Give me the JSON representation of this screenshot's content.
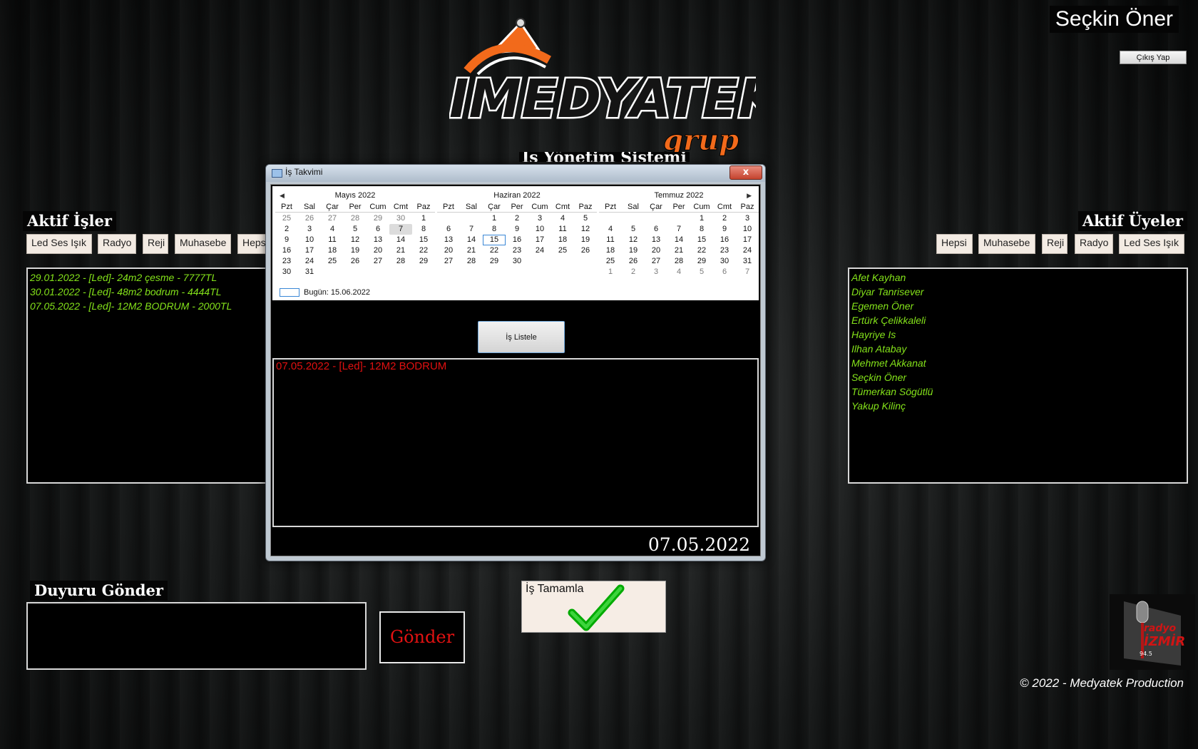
{
  "user_name": "Seçkin Öner",
  "logout_label": "Çıkış Yap",
  "logo": {
    "text": "IMEDYATEK",
    "sub": "grup"
  },
  "system_title_partial": "İş Yönetim Sistemi",
  "active_jobs": {
    "title": "Aktif İşler",
    "filters": [
      "Led Ses Işık",
      "Radyo",
      "Reji",
      "Muhasebe",
      "Hepsi"
    ],
    "items": [
      "29.01.2022 - [Led]- 24m2 çesme - 7777TL",
      "30.01.2022 - [Led]- 48m2 bodrum - 4444TL",
      "07.05.2022 - [Led]- 12M2 BODRUM - 2000TL"
    ]
  },
  "active_members": {
    "title": "Aktif Üyeler",
    "filters": [
      "Hepsi",
      "Muhasebe",
      "Reji",
      "Radyo",
      "Led Ses Işık"
    ],
    "items": [
      "Afet Kayhan",
      "Diyar Tanrisever",
      "Egemen Öner",
      "Ertürk Çelikkaleli",
      "Hayriye Is",
      "Ilhan Atabay",
      "Mehmet Akkanat",
      "Seçkin Öner",
      "Tümerkan Sögütlü",
      "Yakup Kilinç"
    ]
  },
  "dialog": {
    "title": "İş Takvimi",
    "close_label": "x",
    "calendar": {
      "dow": [
        "Pzt",
        "Sal",
        "Çar",
        "Per",
        "Cum",
        "Cmt",
        "Paz"
      ],
      "months": [
        {
          "title": "Mayıs 2022",
          "weeks": [
            [
              "25",
              "26",
              "27",
              "28",
              "29",
              "30",
              "1"
            ],
            [
              "2",
              "3",
              "4",
              "5",
              "6",
              "7",
              "8"
            ],
            [
              "9",
              "10",
              "11",
              "12",
              "13",
              "14",
              "15"
            ],
            [
              "16",
              "17",
              "18",
              "19",
              "20",
              "21",
              "22"
            ],
            [
              "23",
              "24",
              "25",
              "26",
              "27",
              "28",
              "29"
            ],
            [
              "30",
              "31",
              "",
              "",
              "",
              "",
              ""
            ]
          ]
        },
        {
          "title": "Haziran 2022",
          "weeks": [
            [
              "",
              "",
              "1",
              "2",
              "3",
              "4",
              "5"
            ],
            [
              "6",
              "7",
              "8",
              "9",
              "10",
              "11",
              "12"
            ],
            [
              "13",
              "14",
              "15",
              "16",
              "17",
              "18",
              "19"
            ],
            [
              "20",
              "21",
              "22",
              "23",
              "24",
              "25",
              "26"
            ],
            [
              "27",
              "28",
              "29",
              "30",
              "",
              "",
              ""
            ],
            [
              "",
              "",
              "",
              "",
              "",
              "",
              ""
            ]
          ]
        },
        {
          "title": "Temmuz 2022",
          "weeks": [
            [
              "",
              "",
              "",
              "",
              "1",
              "2",
              "3"
            ],
            [
              "4",
              "5",
              "6",
              "7",
              "8",
              "9",
              "10"
            ],
            [
              "11",
              "12",
              "13",
              "14",
              "15",
              "16",
              "17"
            ],
            [
              "18",
              "19",
              "20",
              "21",
              "22",
              "23",
              "24"
            ],
            [
              "25",
              "26",
              "27",
              "28",
              "29",
              "30",
              "31"
            ],
            [
              "1",
              "2",
              "3",
              "4",
              "5",
              "6",
              "7"
            ]
          ]
        }
      ],
      "today_label": "Bugün: 15.06.2022"
    },
    "list_button": "İş Listele",
    "results": [
      "07.05.2022 - [Led]- 12M2 BODRUM"
    ],
    "selected_date": "07.05.2022"
  },
  "announcement": {
    "title": "Duyuru Gönder",
    "send_label": "Gönder"
  },
  "complete_job_label": "İş Tamamla",
  "radio_logo": {
    "line1": "radyo",
    "line2": "İZMİR",
    "line3": "94.5"
  },
  "footer": "© 2022 - Medyatek Production",
  "colors": {
    "accent_green": "#84e21a",
    "alert_red": "#e01010",
    "logo_orange": "#f26a1b"
  }
}
